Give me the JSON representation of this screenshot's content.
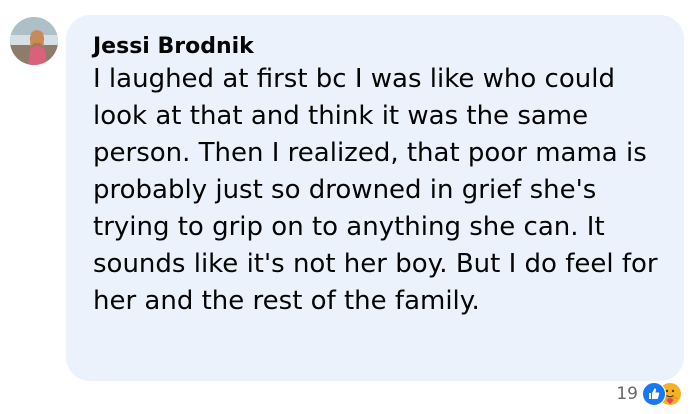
{
  "comment": {
    "author": "Jessi Brodnik",
    "text": "I laughed at first bc I was like who could look at that and think it was the same person. Then I realized, that poor mama is probably just so drowned in grief she's trying to grip on to anything she can. It sounds like it's not her boy. But I do feel for her and the rest of the family.",
    "reaction_count": "19",
    "reaction_icons": [
      "like-icon",
      "care-icon"
    ],
    "colors": {
      "bubble": "#ebf2fc",
      "like_blue": "#1877f2",
      "care_yellow": "#f7b125",
      "meta_text": "#65676b"
    }
  }
}
